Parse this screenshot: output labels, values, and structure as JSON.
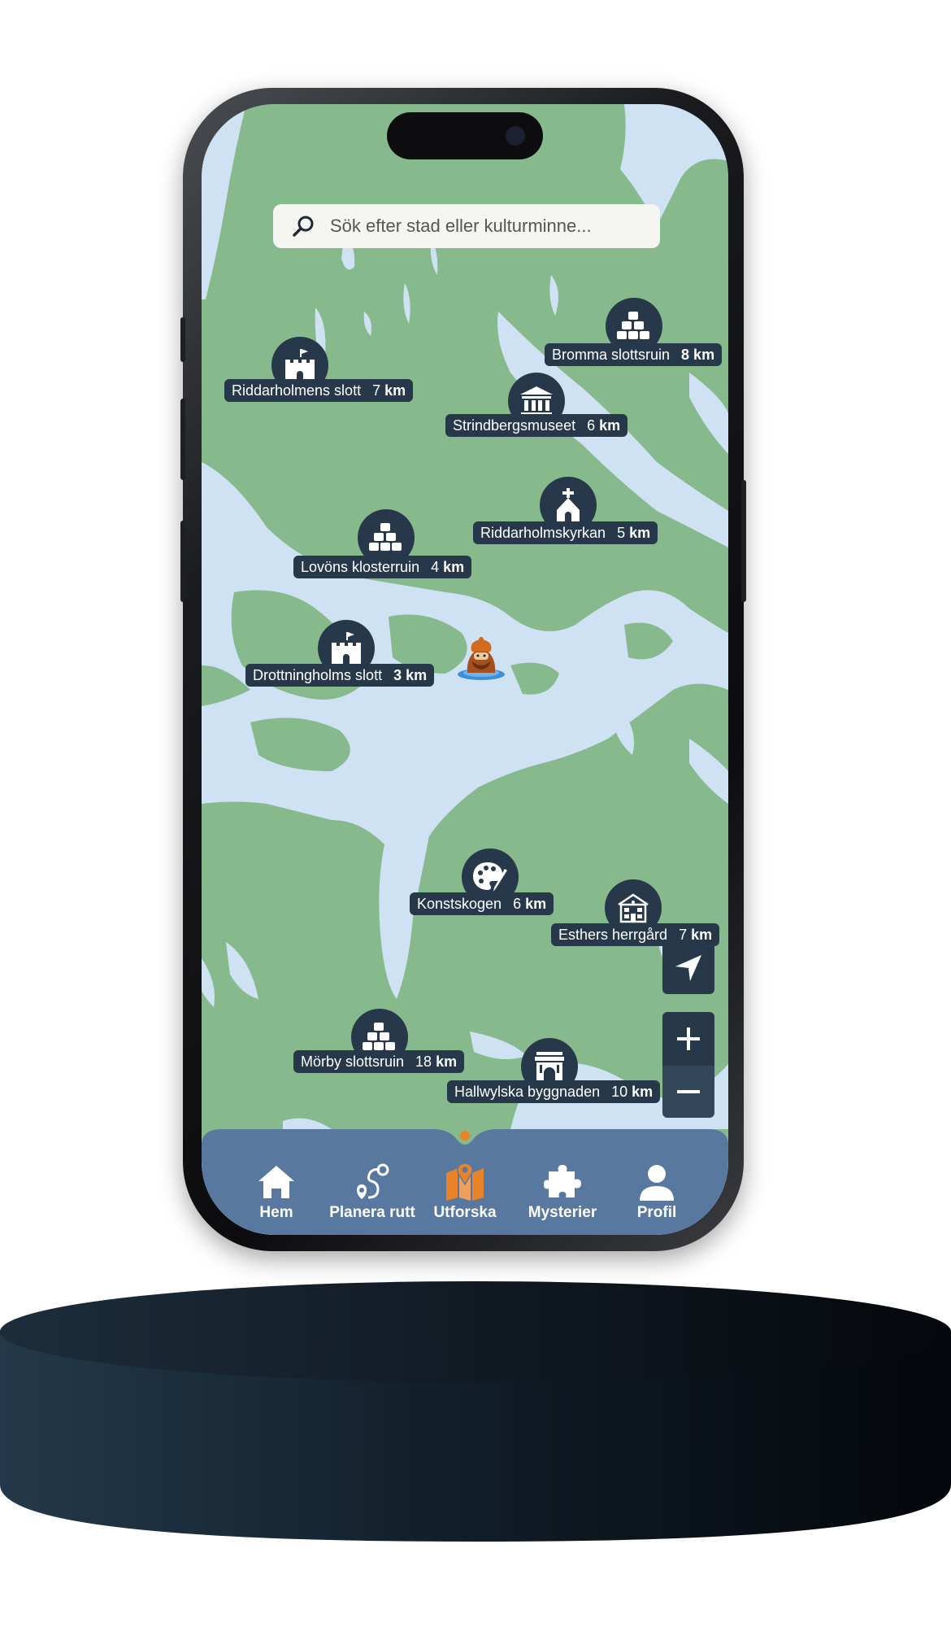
{
  "search": {
    "placeholder": "Sök efter stad eller kulturminne..."
  },
  "pois": [
    {
      "name": "Bromma slottsruin",
      "dist_num": "",
      "dist_unit": "8 km",
      "icon": "ruin-icon"
    },
    {
      "name": "Riddarholmens slott",
      "dist_num": "7",
      "dist_unit": "km",
      "icon": "castle-icon"
    },
    {
      "name": "Strindbergsmuseet",
      "dist_num": "6",
      "dist_unit": "km",
      "icon": "museum-icon"
    },
    {
      "name": "Riddarholmskyrkan",
      "dist_num": "5",
      "dist_unit": "km",
      "icon": "church-icon"
    },
    {
      "name": "Lovöns klosterruin",
      "dist_num": "4",
      "dist_unit": "km",
      "icon": "ruin-icon"
    },
    {
      "name": "Drottningholms slott",
      "dist_num": "",
      "dist_unit": "3 km",
      "icon": "castle-icon"
    },
    {
      "name": "Konstskogen",
      "dist_num": "6",
      "dist_unit": "km",
      "icon": "palette-icon"
    },
    {
      "name": "Esthers herrgård",
      "dist_num": "7",
      "dist_unit": "km",
      "icon": "manor-icon"
    },
    {
      "name": "Mörby slottsruin",
      "dist_num": "18",
      "dist_unit": "km",
      "icon": "ruin-icon"
    },
    {
      "name": "Hallwylska byggnaden",
      "dist_num": "10",
      "dist_unit": "km",
      "icon": "arch-icon"
    }
  ],
  "nav": {
    "items": [
      {
        "label": "Hem",
        "icon": "home-icon"
      },
      {
        "label": "Planera rutt",
        "icon": "route-icon"
      },
      {
        "label": "Utforska",
        "icon": "map-icon",
        "active": true
      },
      {
        "label": "Mysterier",
        "icon": "puzzle-icon"
      },
      {
        "label": "Profil",
        "icon": "profile-icon"
      }
    ]
  },
  "colors": {
    "land": "#86ba8c",
    "water": "#cfe2f3",
    "marker": "#27384a",
    "navbar": "#5878a0",
    "accent": "#e8832a"
  }
}
